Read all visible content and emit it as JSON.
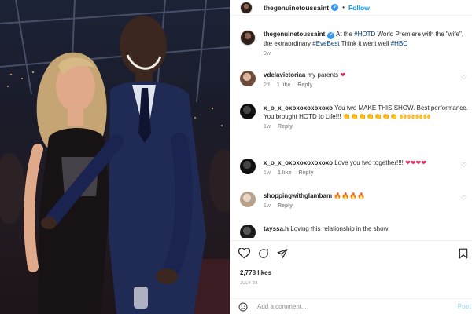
{
  "header": {
    "username": "thegenuinetoussaint",
    "verified_glyph": "✔",
    "separator": "•",
    "follow_label": "Follow"
  },
  "caption": {
    "username": "thegenuinetoussaint",
    "text_before": "At the ",
    "hashtag1": "#HOTD",
    "text_middle": " World Premiere with the \"wife\", the extraordinary ",
    "hashtag2": "#EveBest",
    "text_after": " Think it went well ",
    "hashtag3": "#HBO",
    "age": "9w"
  },
  "comments": [
    {
      "username": "vdelavictoriaa",
      "text": "my parents",
      "emoji": "❤",
      "age": "2d",
      "likes": "1 like",
      "reply": "Reply"
    },
    {
      "username": "x_o_x_oxoxoxoxoxoxo",
      "text": "You two MAKE THIS SHOW. Best performance. You brought HOTD to Life!!!",
      "emoji": "👏👏👏👏👏👏👏",
      "emoji2": "🙌🙌🙌🙌",
      "age": "1w",
      "reply": "Reply"
    },
    {
      "username": "x_o_x_oxoxoxoxoxoxo",
      "text": "Love you two together!!!!",
      "emoji": "❤❤❤❤",
      "age": "1w",
      "likes": "1 like",
      "reply": "Reply"
    },
    {
      "username": "shoppingwithglambam",
      "text": "",
      "emoji": "🔥🔥🔥🔥",
      "age": "1w",
      "reply": "Reply"
    },
    {
      "username": "tayssa.h",
      "text": "Loving this relationship in the show"
    }
  ],
  "actions": {
    "like_icon": "heart-outline-icon",
    "comment_icon": "comment-icon",
    "share_icon": "share-icon",
    "save_icon": "bookmark-icon"
  },
  "likes_text": "2,778 likes",
  "post_date": "JULY 28",
  "add_comment": {
    "placeholder": "Add a comment...",
    "post_label": "Post"
  },
  "colors": {
    "link_blue": "#0095f6",
    "hashtag": "#00376b",
    "muted": "#8e8e8e",
    "verified": "#3897f0"
  }
}
